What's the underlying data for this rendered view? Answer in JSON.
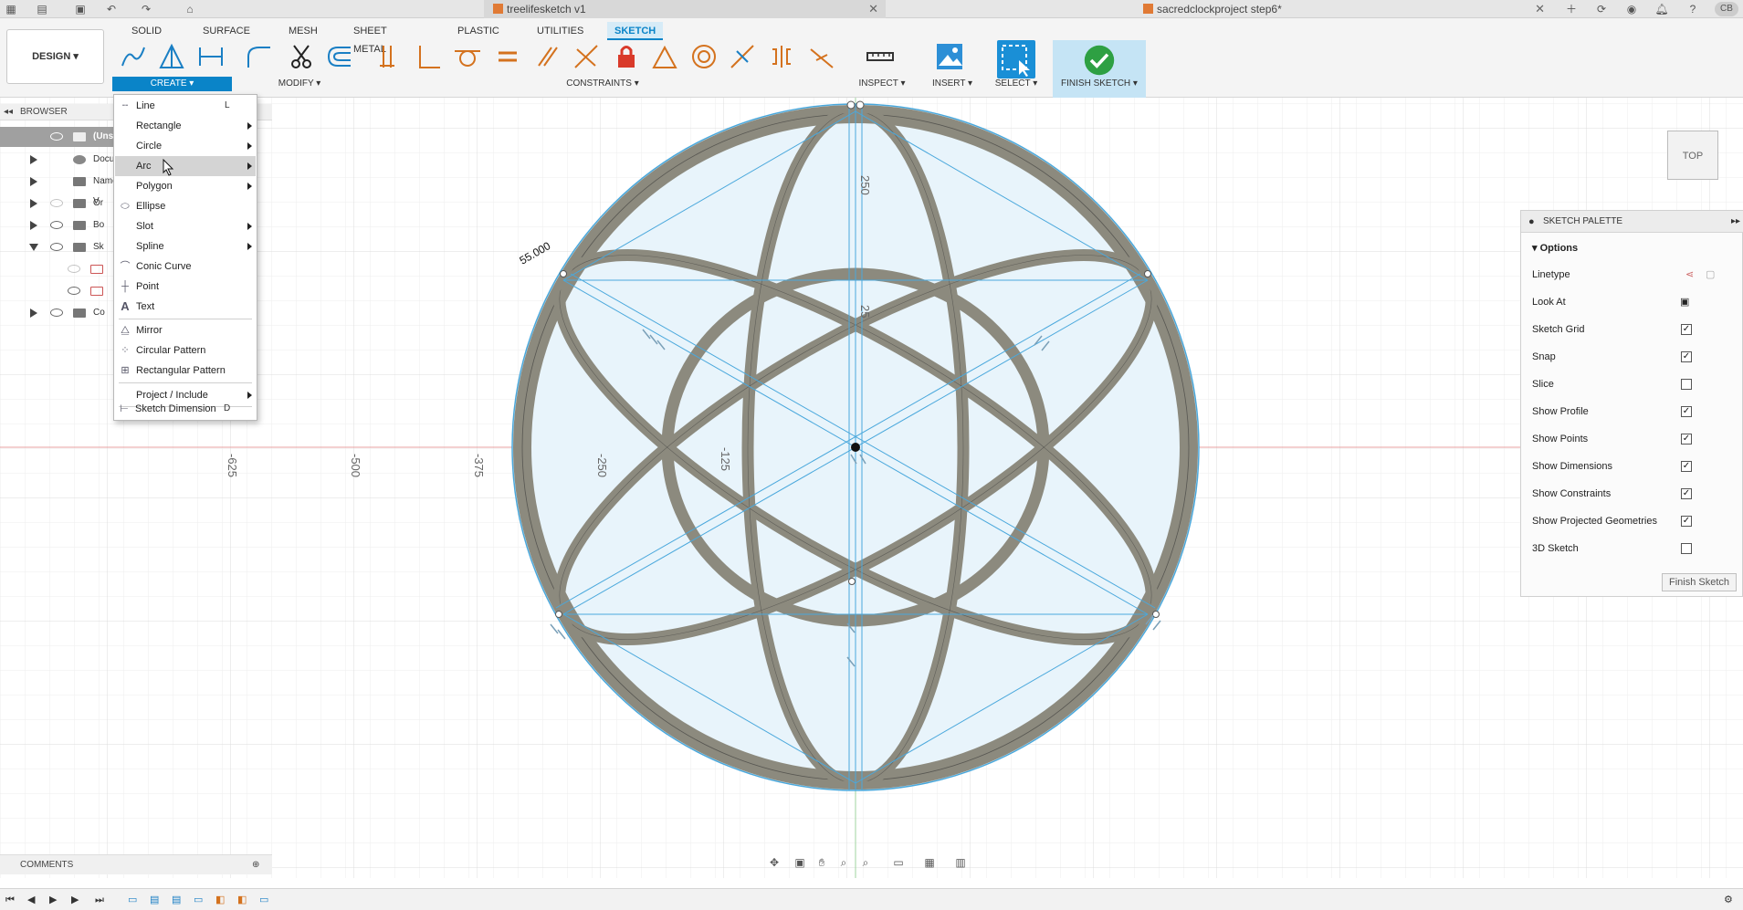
{
  "titlebar": {
    "inactive_tab": "treelifesketch v1",
    "active_tab": "sacredclockproject step6*",
    "close_glyph": "✕",
    "user_initials": "CB"
  },
  "workspace_tabs": [
    "SOLID",
    "SURFACE",
    "MESH",
    "SHEET METAL",
    "PLASTIC",
    "UTILITIES",
    "SKETCH"
  ],
  "design_button": "DESIGN ▾",
  "toolbar_groups": {
    "create": "CREATE ▾",
    "modify": "MODIFY ▾",
    "constraints": "CONSTRAINTS ▾",
    "inspect": "INSPECT ▾",
    "insert": "INSERT ▾",
    "select": "SELECT ▾",
    "finish": "FINISH SKETCH ▾"
  },
  "browser": {
    "title": "BROWSER",
    "rows": [
      {
        "label": "(Unsa"
      },
      {
        "label": "Docume"
      },
      {
        "label": "Named V"
      },
      {
        "label": "Or"
      },
      {
        "label": "Bo"
      },
      {
        "label": "Sk"
      },
      {
        "label": ""
      },
      {
        "label": ""
      },
      {
        "label": "Co"
      }
    ]
  },
  "create_menu": {
    "items": [
      {
        "label": "Line",
        "shortcut": "L",
        "icon": "line-icon"
      },
      {
        "label": "Rectangle",
        "submenu": true,
        "icon": ""
      },
      {
        "label": "Circle",
        "submenu": true,
        "icon": ""
      },
      {
        "label": "Arc",
        "submenu": true,
        "icon": "",
        "hovered": true
      },
      {
        "label": "Polygon",
        "submenu": true,
        "icon": ""
      },
      {
        "label": "Ellipse",
        "icon": "ellipse-icon"
      },
      {
        "label": "Slot",
        "submenu": true,
        "icon": ""
      },
      {
        "label": "Spline",
        "submenu": true,
        "icon": ""
      },
      {
        "label": "Conic Curve",
        "icon": "conic-curve-icon"
      },
      {
        "label": "Point",
        "icon": "point-icon"
      },
      {
        "label": "Text",
        "icon": "text-icon"
      },
      {
        "label": "Mirror",
        "icon": "mirror-icon"
      },
      {
        "label": "Circular Pattern",
        "icon": "circular-pattern-icon"
      },
      {
        "label": "Rectangular Pattern",
        "icon": "rectangular-pattern-icon"
      },
      {
        "label": "Project / Include",
        "submenu": true,
        "icon": ""
      },
      {
        "label": "Sketch Dimension",
        "shortcut": "D",
        "icon": "sketch-dimension-icon"
      }
    ]
  },
  "sketch_palette": {
    "title": "SKETCH PALETTE",
    "section": "Options",
    "options": [
      {
        "label": "Linetype",
        "type": "icons"
      },
      {
        "label": "Look At",
        "type": "button"
      },
      {
        "label": "Sketch Grid",
        "checked": true
      },
      {
        "label": "Snap",
        "checked": true
      },
      {
        "label": "Slice",
        "checked": false
      },
      {
        "label": "Show Profile",
        "checked": true
      },
      {
        "label": "Show Points",
        "checked": true
      },
      {
        "label": "Show Dimensions",
        "checked": true
      },
      {
        "label": "Show Constraints",
        "checked": true
      },
      {
        "label": "Show Projected Geometries",
        "checked": true
      },
      {
        "label": "3D Sketch",
        "checked": false
      }
    ],
    "finish_button": "Finish Sketch"
  },
  "canvas": {
    "axis_labels": [
      "-625",
      "-500",
      "-375",
      "-250",
      "-125",
      "250",
      "25"
    ],
    "viewcube_label": "TOP",
    "dimension_text": "55.000"
  },
  "comments": {
    "title": "COMMENTS"
  },
  "colors": {
    "accent": "#0a84c8",
    "sketch_fill": "#e8f4fb",
    "solid_gray": "#8c8a7e",
    "construction_blue": "#4aa8dc",
    "axis_red": "#e8a0a0",
    "axis_green": "#9fd49f"
  }
}
